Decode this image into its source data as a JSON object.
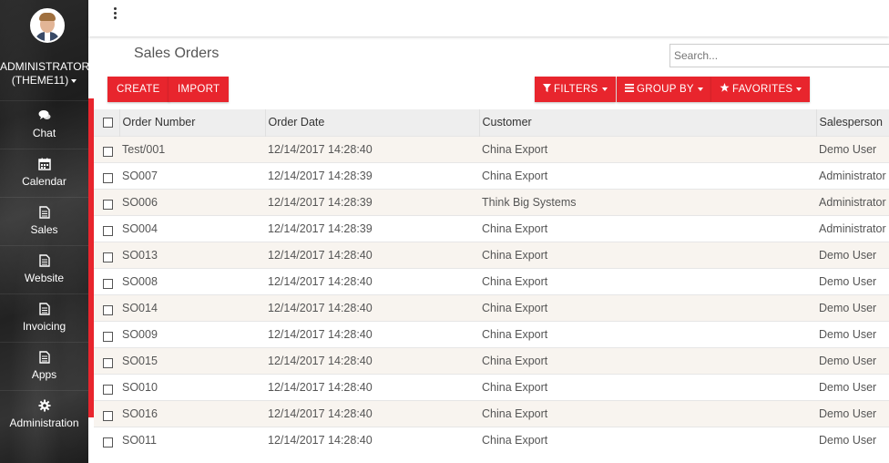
{
  "sidebar": {
    "user_line1": "ADMINISTRATOR",
    "user_line2": "(THEME11)",
    "items": [
      {
        "label": "Chat",
        "icon": "comments-icon"
      },
      {
        "label": "Calendar",
        "icon": "calendar-icon"
      },
      {
        "label": "Sales",
        "icon": "document-icon"
      },
      {
        "label": "Website",
        "icon": "document-icon"
      },
      {
        "label": "Invoicing",
        "icon": "document-icon"
      },
      {
        "label": "Apps",
        "icon": "document-icon"
      },
      {
        "label": "Administration",
        "icon": "gear-icon"
      }
    ]
  },
  "page": {
    "title": "Sales Orders",
    "search_placeholder": "Search..."
  },
  "buttons": {
    "create": "CREATE",
    "import": "IMPORT",
    "filters": "FILTERS",
    "group_by": "GROUP BY",
    "favorites": "FAVORITES"
  },
  "table": {
    "columns": [
      "Order Number",
      "Order Date",
      "Customer",
      "Salesperson"
    ],
    "rows": [
      [
        "Test/001",
        "12/14/2017 14:28:40",
        "China Export",
        "Demo User"
      ],
      [
        "SO007",
        "12/14/2017 14:28:39",
        "China Export",
        "Administrator"
      ],
      [
        "SO006",
        "12/14/2017 14:28:39",
        "Think Big Systems",
        "Administrator"
      ],
      [
        "SO004",
        "12/14/2017 14:28:39",
        "China Export",
        "Administrator"
      ],
      [
        "SO013",
        "12/14/2017 14:28:40",
        "China Export",
        "Demo User"
      ],
      [
        "SO008",
        "12/14/2017 14:28:40",
        "China Export",
        "Demo User"
      ],
      [
        "SO014",
        "12/14/2017 14:28:40",
        "China Export",
        "Demo User"
      ],
      [
        "SO009",
        "12/14/2017 14:28:40",
        "China Export",
        "Demo User"
      ],
      [
        "SO015",
        "12/14/2017 14:28:40",
        "China Export",
        "Demo User"
      ],
      [
        "SO010",
        "12/14/2017 14:28:40",
        "China Export",
        "Demo User"
      ],
      [
        "SO016",
        "12/14/2017 14:28:40",
        "China Export",
        "Demo User"
      ],
      [
        "SO011",
        "12/14/2017 14:28:40",
        "China Export",
        "Demo User"
      ]
    ]
  },
  "colors": {
    "accent": "#e8252d",
    "row_alt": "#f8f4ef",
    "header_bg": "#eeeeee"
  }
}
